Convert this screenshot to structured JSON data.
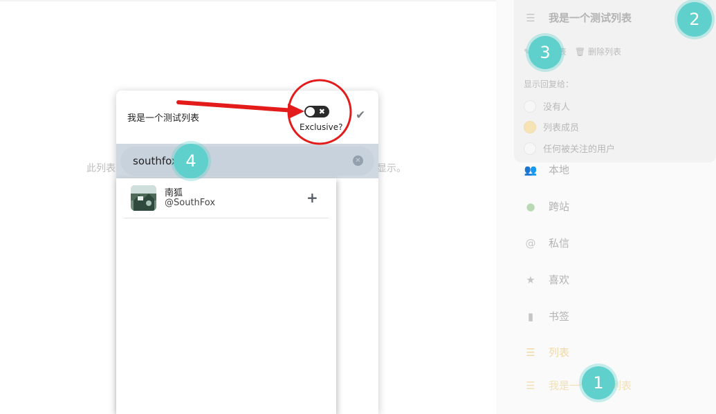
{
  "main": {
    "bg_text_left": "此列表",
    "bg_text_right": "显示。"
  },
  "sidebar": {
    "list_header": {
      "icon": "list-icon",
      "label": "我是一个测试列表"
    },
    "actions": {
      "edit": "编辑列表",
      "delete": "删除列表"
    },
    "show_replies_label": "显示回复给：",
    "reply_options": [
      {
        "label": "没有人",
        "selected": false
      },
      {
        "label": "列表成员",
        "selected": true
      },
      {
        "label": "任何被关注的用户",
        "selected": false
      }
    ],
    "nav_items": [
      {
        "icon": "users-icon",
        "label": "本地"
      },
      {
        "icon": "globe-icon",
        "label": "跨站"
      },
      {
        "icon": "at-icon",
        "label": "私信"
      },
      {
        "icon": "star-icon",
        "label": "喜欢"
      },
      {
        "icon": "bookmark-icon",
        "label": "书签"
      },
      {
        "icon": "list-icon",
        "label": "列表"
      },
      {
        "icon": "list-icon",
        "label": "我是一个测试列表"
      }
    ]
  },
  "dialog": {
    "title": "我是一个测试列表",
    "exclusive_label": "Exclusive?",
    "exclusive_on": false,
    "search": {
      "value": "southfox"
    },
    "results": [
      {
        "name": "南狐",
        "handle": "@SouthFox"
      }
    ]
  },
  "annotations": [
    "1",
    "2",
    "3",
    "4"
  ]
}
